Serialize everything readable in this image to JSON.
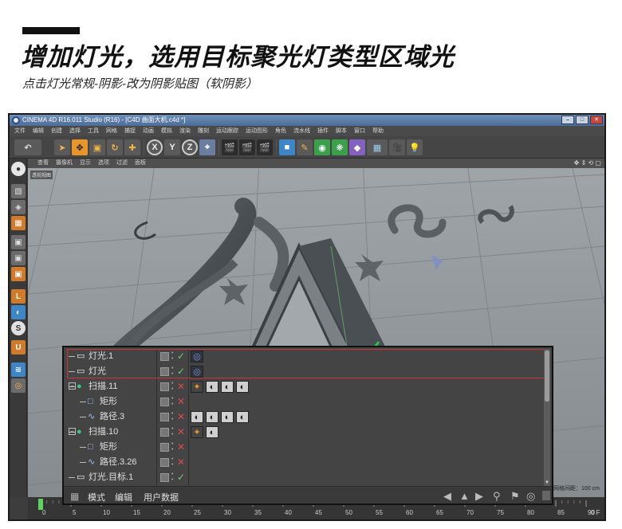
{
  "header": {
    "headline": "增加灯光，选用目标聚光灯类型区域光",
    "subline": "点击灯光常规-阴影-改为阴影贴图（软阴影）"
  },
  "window": {
    "title": "CINEMA 4D R16.011 Studio (R16) - [C4D 曲面大机.c4d *]"
  },
  "menubar": {
    "items": [
      "文件",
      "编辑",
      "创建",
      "选择",
      "工具",
      "网格",
      "捕捉",
      "动画",
      "模拟",
      "渲染",
      "雕刻",
      "运动跟踪",
      "运动图形",
      "角色",
      "流水线",
      "插件",
      "脚本",
      "窗口",
      "帮助"
    ]
  },
  "viewport": {
    "menu_items": [
      "查看",
      "摄像机",
      "显示",
      "选项",
      "过滤",
      "面板"
    ],
    "label": "透视视图",
    "grid_spacing": "网格间距：100 cm"
  },
  "object_manager": {
    "rows": [
      {
        "name": "灯光.1",
        "icon": "light-icon",
        "depth": 0,
        "check": "✓",
        "tags": [
          "target-tag-icon"
        ]
      },
      {
        "name": "灯光",
        "icon": "light-icon",
        "depth": 0,
        "check": "✓",
        "tags": [
          "target-tag-icon"
        ]
      },
      {
        "name": "扫描.11",
        "icon": "sweep-icon",
        "depth": 0,
        "check": "✕",
        "tags": [
          "phong-tag-icon",
          "material-tag-icon",
          "material-tag-icon",
          "material-tag-icon"
        ]
      },
      {
        "name": "矩形",
        "icon": "rectangle-icon",
        "depth": 1,
        "check": "✕",
        "tags": []
      },
      {
        "name": "路径.3",
        "icon": "spline-icon",
        "depth": 1,
        "check": "✕",
        "tags": [
          "material-tag-icon",
          "material-tag-icon",
          "material-tag-icon",
          "material-tag-icon"
        ]
      },
      {
        "name": "扫描.10",
        "icon": "sweep-icon",
        "depth": 0,
        "check": "✕",
        "tags": [
          "phong-tag-icon",
          "material-tag-icon"
        ]
      },
      {
        "name": "矩形",
        "icon": "rectangle-icon",
        "depth": 1,
        "check": "✕",
        "tags": []
      },
      {
        "name": "路径.3.26",
        "icon": "spline-icon",
        "depth": 1,
        "check": "✕",
        "tags": []
      },
      {
        "name": "灯光.目标.1",
        "icon": "light-icon",
        "depth": 0,
        "check": "✓",
        "tags": []
      }
    ],
    "bottom_tabs": [
      "模式",
      "编辑",
      "用户数据"
    ]
  },
  "timeline": {
    "start_frame": "0",
    "ticks": [
      "0",
      "5",
      "10",
      "15",
      "20",
      "25",
      "30",
      "35",
      "40",
      "45",
      "50",
      "55",
      "60",
      "65",
      "70",
      "75",
      "80",
      "85",
      "90"
    ],
    "current_frame": "0 F"
  },
  "colors": {
    "selection_border": "#c4373f",
    "accent_orange": "#e8962a",
    "viewport_bg": "#9aa0a4",
    "manager_bg": "#444444",
    "target_tag": "#7f8fc7"
  }
}
